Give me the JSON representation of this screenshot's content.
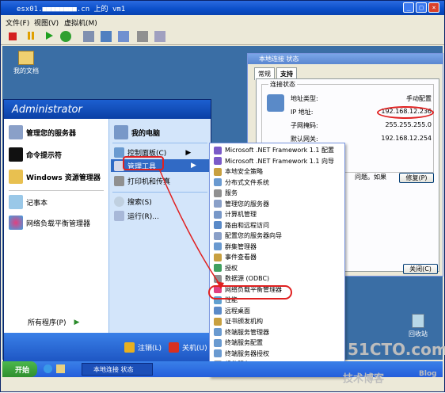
{
  "window": {
    "title": "esx01.■■■■■■■■.cn 上的 vm1",
    "menu": [
      "文件(F)",
      "视图(V)",
      "虚拟机(M)"
    ]
  },
  "desktop": {
    "icons": [
      {
        "label": "我的文档"
      },
      {
        "label": "回收站"
      }
    ]
  },
  "status_dialog": {
    "title": "本地连接 状态",
    "tabs": [
      "常规",
      "支持"
    ],
    "group_label": "连接状态",
    "rows": [
      {
        "label": "地址类型:",
        "value": "手动配置"
      },
      {
        "label": "IP 地址:",
        "value": "192.168.12.236"
      },
      {
        "label": "子网掩码:",
        "value": "255.255.255.0"
      },
      {
        "label": "默认网关:",
        "value": "192.168.12.254"
      }
    ],
    "hint": "问题。如果",
    "repair_button": "修复(P)",
    "close_button": "关闭(C)"
  },
  "start_menu": {
    "user": "Administrator",
    "left_items": [
      "管理您的服务器",
      "命令提示符",
      "Windows 资源管理器",
      "记事本",
      "网络负载平衡管理器"
    ],
    "all_programs": "所有程序(P)",
    "right_items": [
      "我的电脑",
      "控制面板(C)",
      "管理工具",
      "打印机和传真",
      "搜索(S)",
      "运行(R)..."
    ],
    "logoff": "注销(L)",
    "shutdown": "关机(U)"
  },
  "admin_tools": [
    "Microsoft .NET Framework 1.1 配置",
    "Microsoft .NET Framework 1.1 向导",
    "本地安全策略",
    "分布式文件系统",
    "服务",
    "管理您的服务器",
    "计算机管理",
    "路由和远程访问",
    "配置您的服务器向导",
    "群集管理器",
    "事件查看器",
    "授权",
    "数据源 (ODBC)",
    "网络负载平衡管理器",
    "性能",
    "远程桌面",
    "证书颁发机构",
    "终端服务管理器",
    "终端服务配置",
    "终端服务器授权",
    "组件服务"
  ],
  "taskbar": {
    "start": "开始",
    "task": "本地连接 状态"
  },
  "watermark": {
    "brand": "51CTO.com",
    "sub": "技术博客",
    "tag": "Blog"
  }
}
